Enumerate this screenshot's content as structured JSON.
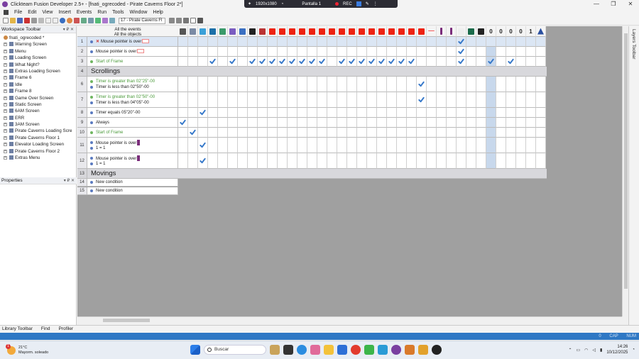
{
  "window": {
    "title": "Clickteam Fusion Developer 2.5+ - [fnati_ogrecoded - Pirate Caverns Floor 2*]",
    "controls": [
      "—",
      "❐",
      "✕"
    ]
  },
  "recorder": {
    "resolution": "1920x1080",
    "screen": "Pantalla 1",
    "rec": "REC"
  },
  "menu": [
    "File",
    "Edit",
    "View",
    "Insert",
    "Events",
    "Run",
    "Tools",
    "Window",
    "Help"
  ],
  "toolbar": {
    "frame_select": "17 - Pirate Caverns Fl"
  },
  "workspace": {
    "title": "Workspace Toolbar",
    "controls": "▾ ₽ ✕",
    "root": "fnati_ogrecoded *",
    "frames": [
      "Warning Screen",
      "Menu",
      "Loading Screen",
      "What Night?",
      "Extras Loading Screen",
      "Frame 6",
      "Idle",
      "Frame 8",
      "Game Over Screen",
      "Static Screen",
      "6AM Screen",
      "ERR",
      "3AM Screen",
      "Pirate Caverns Loading Scre",
      "Pirate Caverns Floor 1",
      "Elevator Loading Screen",
      "Pirate Caverns Floor 2",
      "Extras Menu"
    ]
  },
  "properties": {
    "title": "Properties",
    "controls": "▾ ₽ ✕"
  },
  "layers": {
    "title": "Layers Toolbar"
  },
  "editor": {
    "header_line1": "All the events",
    "header_line2": "All the objects",
    "counter_digits": [
      "0",
      "0",
      "0",
      "0",
      "1"
    ],
    "rows": [
      {
        "kind": "event",
        "num": "1",
        "selected": true,
        "conds": [
          {
            "text": "Mouse pointer is over",
            "color": "blue",
            "swatch": "box",
            "negated": true
          }
        ],
        "checks": [
          28
        ]
      },
      {
        "kind": "event",
        "num": "2",
        "conds": [
          {
            "text": "Mouse pointer is over",
            "color": "blue",
            "swatch": "box"
          }
        ],
        "checks": [
          28
        ]
      },
      {
        "kind": "event",
        "num": "3",
        "conds": [
          {
            "text": "Start of Frame",
            "color": "green"
          }
        ],
        "checks": [
          3,
          5,
          7,
          8,
          9,
          10,
          11,
          12,
          13,
          14,
          16,
          17,
          18,
          19,
          20,
          21,
          22,
          23,
          28,
          31,
          33
        ]
      },
      {
        "kind": "group",
        "num": "4",
        "title": "Scrollings"
      },
      {
        "kind": "event",
        "num": "6",
        "height": 2,
        "conds": [
          {
            "text": "Timer is greater than 02\"25\"-00",
            "color": "green"
          },
          {
            "text": "Timer is less than 02\"50\"-00",
            "color": "blue"
          }
        ],
        "checks": [
          24
        ]
      },
      {
        "kind": "event",
        "num": "7",
        "height": 2,
        "conds": [
          {
            "text": "Timer is greater than 02\"50\"-00",
            "color": "green"
          },
          {
            "text": "Timer is less than 04\"05\"-00",
            "color": "blue"
          }
        ],
        "checks": [
          24
        ]
      },
      {
        "kind": "event",
        "num": "8",
        "conds": [
          {
            "text": "Timer equals 05\"20\"-00",
            "color": "blue"
          }
        ],
        "checks": [
          2
        ]
      },
      {
        "kind": "event",
        "num": "9",
        "conds": [
          {
            "text": "Always",
            "color": "blue"
          }
        ],
        "checks": [
          0
        ]
      },
      {
        "kind": "event",
        "num": "10",
        "conds": [
          {
            "text": "Start of Frame",
            "color": "green"
          }
        ],
        "checks": [
          1
        ]
      },
      {
        "kind": "event",
        "num": "11",
        "height": 2,
        "conds": [
          {
            "text": "Mouse pointer is over",
            "color": "blue",
            "swatch": "purple"
          },
          {
            "text": "1  = 1",
            "color": "blue"
          }
        ],
        "checks": [
          2
        ]
      },
      {
        "kind": "event",
        "num": "12",
        "height": 2,
        "conds": [
          {
            "text": "Mouse pointer is over",
            "color": "blue",
            "swatch": "purple"
          },
          {
            "text": "1  = 1",
            "color": "blue"
          }
        ],
        "checks": [
          2
        ]
      },
      {
        "kind": "group",
        "num": "13",
        "title": "Movings"
      },
      {
        "kind": "new",
        "num": "14",
        "text": "New condition"
      },
      {
        "kind": "new",
        "num": "15",
        "text": "New condition"
      }
    ]
  },
  "bottom_tabs": [
    "Library Toolbar",
    "Find",
    "Profiler"
  ],
  "status": {
    "left": "0",
    "cap": "CAP",
    "num": "NUM"
  },
  "taskbar": {
    "temp": "21°C",
    "weather": "Mayorm. soleado",
    "badge": "1",
    "search": "Buscar",
    "time": "14:26",
    "date": "10/12/2025"
  },
  "colors": {
    "accent": "#3477c9",
    "selected_row": "#dbe6f4",
    "group_bar": "#d8d8dc",
    "status_bar": "#2f78c4"
  }
}
